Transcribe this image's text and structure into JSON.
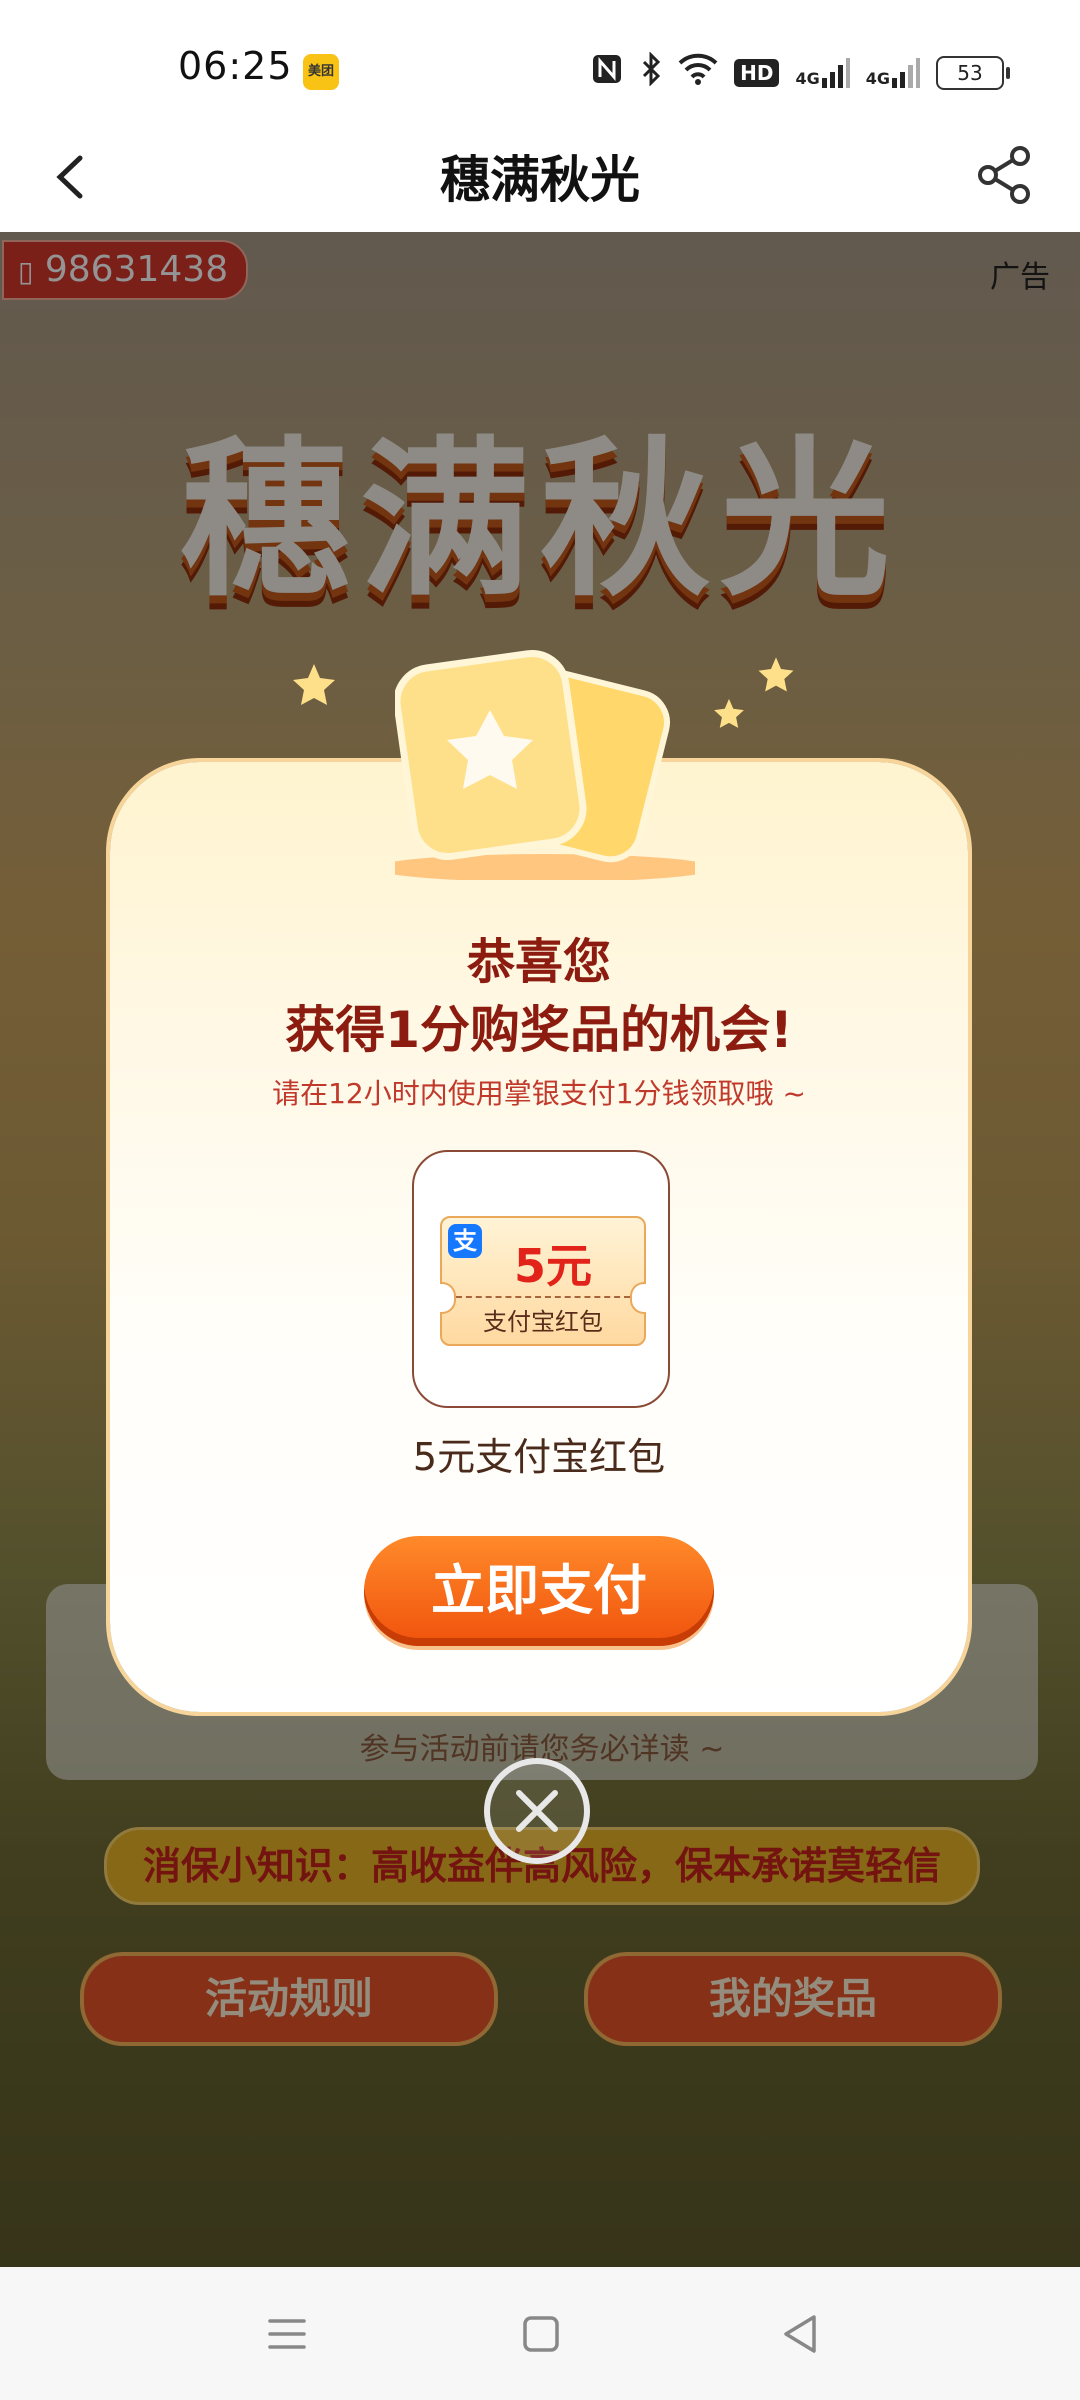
{
  "status_bar": {
    "time": "06:25",
    "app_badge": "美团",
    "network": "HD",
    "signal_1": "4G",
    "signal_2": "4G",
    "battery": "53"
  },
  "header": {
    "title": "穗满秋光"
  },
  "background": {
    "phone_number": "98631438",
    "ad_label": "广告",
    "big_title": "穗满秋光",
    "info_text": "参与活动前请您务必详读 ~",
    "knowledge_banner": "消保小知识：高收益伴高风险，保本承诺莫轻信",
    "rules_button": "活动规则",
    "prizes_button": "我的奖品"
  },
  "modal": {
    "heading_1": "恭喜您",
    "heading_2": "获得1分购奖品的机会!",
    "subtitle": "请在12小时内使用掌银支付1分钱领取哦 ~",
    "coupon_amount": "5元",
    "coupon_label": "支付宝红包",
    "alipay_glyph": "支",
    "prize_name": "5元支付宝红包",
    "pay_button": "立即支付"
  },
  "colors": {
    "accent": "#f0520c",
    "heading": "#8c1c10",
    "subtitle": "#c0392b"
  }
}
